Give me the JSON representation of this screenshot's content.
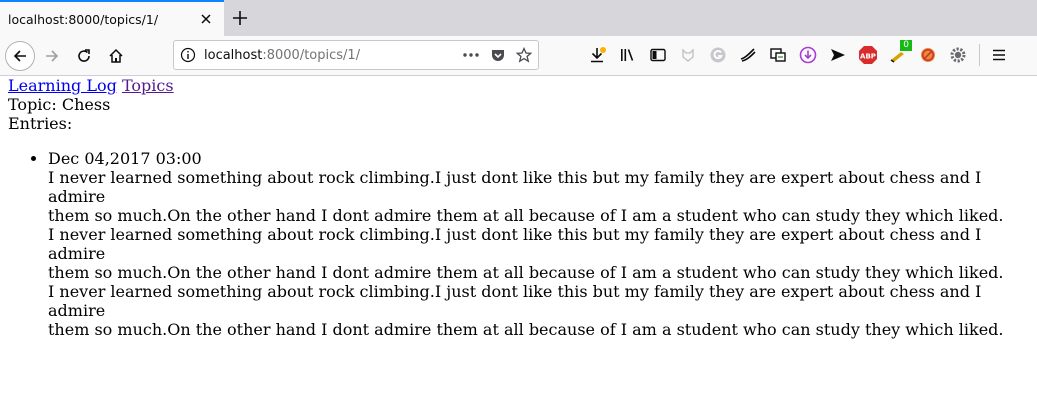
{
  "browser": {
    "tab_title": "localhost:8000/topics/1/",
    "url_host": "localhost",
    "url_rest": ":8000/topics/1/",
    "addon_badge": "0"
  },
  "page": {
    "nav": {
      "home_link": "Learning Log",
      "topics_link": "Topics"
    },
    "topic_heading": "Topic: Chess",
    "entries_label": "Entries:",
    "entries": [
      {
        "date": "Dec 04,2017 03:00",
        "lines": [
          "I never learned something about rock climbing.I just dont like this but my family they are expert about chess and I admire",
          "them so much.On the other hand I dont admire them at all because of I am a student who can study they which liked.",
          "I never learned something about rock climbing.I just dont like this but my family they are expert about chess and I admire",
          "them so much.On the other hand I dont admire them at all because of I am a student who can study they which liked.",
          "I never learned something about rock climbing.I just dont like this but my family they are expert about chess and I admire",
          "them so much.On the other hand I dont admire them at all because of I am a student who can study they which liked."
        ]
      }
    ]
  },
  "colors": {
    "tab_accent": "#0a84ff",
    "link": "#0000ee",
    "visited_link": "#551a8b",
    "abp_red": "#d92d2d",
    "badge_green": "#16b916"
  }
}
